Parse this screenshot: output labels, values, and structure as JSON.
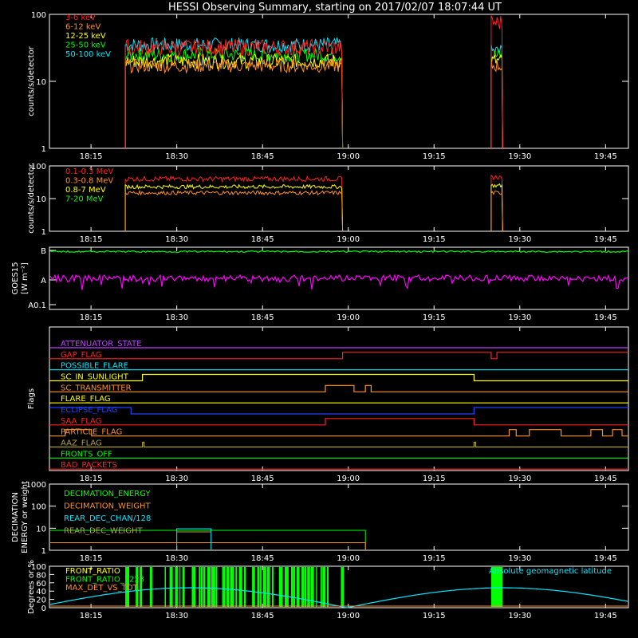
{
  "title": "HESSI Observing Summary, starting on 2017/02/07 18:07:44 UT",
  "time_ticks": [
    "18:15",
    "18:30",
    "18:45",
    "19:00",
    "19:15",
    "19:30",
    "19:45"
  ],
  "chart_data": [
    {
      "type": "line",
      "ylabel": "counts/s/detector",
      "yscale": "log",
      "ylim": [
        1,
        100
      ],
      "yticks": [
        "1",
        "10",
        "100"
      ],
      "legend": "top-left",
      "series": [
        {
          "name": "3-6 keV",
          "color": "#ff2020",
          "level": 32,
          "noise": 0.25,
          "burst": 75
        },
        {
          "name": "6-12 keV",
          "color": "#ff9020",
          "level": 17,
          "noise": 0.2,
          "burst": 17
        },
        {
          "name": "12-25 keV",
          "color": "#ffff00",
          "level": 20,
          "noise": 0.22,
          "burst": 20
        },
        {
          "name": "25-50 keV",
          "color": "#00ff00",
          "level": 25,
          "noise": 0.22,
          "burst": 24
        },
        {
          "name": "50-100 keV",
          "color": "#00e8ff",
          "level": 35,
          "noise": 0.22,
          "burst": 28
        }
      ],
      "active": [
        [
          "18:21",
          "18:59"
        ],
        [
          "19:25",
          "19:27"
        ]
      ]
    },
    {
      "type": "line",
      "ylabel": "counts/s/detector",
      "yscale": "log",
      "ylim": [
        1,
        100
      ],
      "yticks": [
        "1",
        "10",
        "100"
      ],
      "legend": "top-left",
      "series": [
        {
          "name": "0.1-0.3 MeV",
          "color": "#ff2020",
          "level": 40,
          "noise": 0.15,
          "burst": 45
        },
        {
          "name": "0.3-0.8 MeV",
          "color": "#ff9020",
          "level": 15,
          "noise": 0.12,
          "burst": 15
        },
        {
          "name": "0.8-7 MeV",
          "color": "#ffff00",
          "level": 23,
          "noise": 0.12,
          "burst": 25
        },
        {
          "name": "7-20 MeV",
          "color": "#00ff00",
          "level": 0,
          "noise": 0,
          "burst": 0
        }
      ],
      "active": [
        [
          "18:21",
          "18:59"
        ],
        [
          "19:25",
          "19:27"
        ]
      ]
    },
    {
      "type": "line",
      "ylabel": "GOES15",
      "ylabel2": "[W m⁻²]",
      "yticks": [
        "A0.1",
        "A",
        "B"
      ],
      "series": [
        {
          "name": "GOES long",
          "color": "#00ff00",
          "level": 0.93
        },
        {
          "name": "GOES short",
          "color": "#ff00ff",
          "level": 0.5
        }
      ]
    },
    {
      "type": "line",
      "ylabel": "Flags",
      "flags": [
        {
          "name": "ATTENUATOR_STATE",
          "color": "#c040ff"
        },
        {
          "name": "GAP_FLAG",
          "color": "#ff2020"
        },
        {
          "name": "POSSIBLE_FLARE",
          "color": "#00e8ff"
        },
        {
          "name": "SC_IN_SUNLIGHT",
          "color": "#ffff00"
        },
        {
          "name": "SC_TRANSMITTER",
          "color": "#ff9020"
        },
        {
          "name": "FLARE_FLAG",
          "color": "#ffff00"
        },
        {
          "name": "ECLIPSE_FLAG",
          "color": "#2040ff"
        },
        {
          "name": "SAA_FLAG",
          "color": "#ff2020"
        },
        {
          "name": "PARTICLE_FLAG",
          "color": "#ff9020"
        },
        {
          "name": "AAZ_FLAG",
          "color": "#b0a040"
        },
        {
          "name": "FRONTS_OFF",
          "color": "#00ff00"
        },
        {
          "name": "BAD_PACKETS",
          "color": "#ff2020"
        }
      ]
    },
    {
      "type": "line",
      "ylabel": "DECIMATION",
      "ylabel2": "ENERGY or weight",
      "yscale": "log",
      "ylim": [
        1,
        1000
      ],
      "yticks": [
        "1",
        "10",
        "100",
        "1000"
      ],
      "series": [
        {
          "name": "DECIMATION_ENERGY",
          "color": "#00ff00"
        },
        {
          "name": "DECIMATION_WEIGHT",
          "color": "#ff9020"
        },
        {
          "name": "REAR_DEC_CHAN/128",
          "color": "#00e8ff"
        },
        {
          "name": "REAR_DEC_WEIGHT",
          "color": "#b0a040"
        }
      ]
    },
    {
      "type": "line",
      "ylabel": "Degrees or %",
      "ylim": [
        0,
        100
      ],
      "yticks": [
        "0",
        "20",
        "40",
        "60",
        "80",
        "100"
      ],
      "series": [
        {
          "name": "FRONT_RATIO",
          "color": "#ffff00"
        },
        {
          "name": "FRONT_RATIO_1223",
          "color": "#00ff00"
        },
        {
          "name": "MAX_DET_VS_TOT",
          "color": "#ff9020"
        }
      ],
      "annotation": {
        "text": "Absolute geomagnetic latitude",
        "color": "#00e8ff"
      }
    }
  ]
}
